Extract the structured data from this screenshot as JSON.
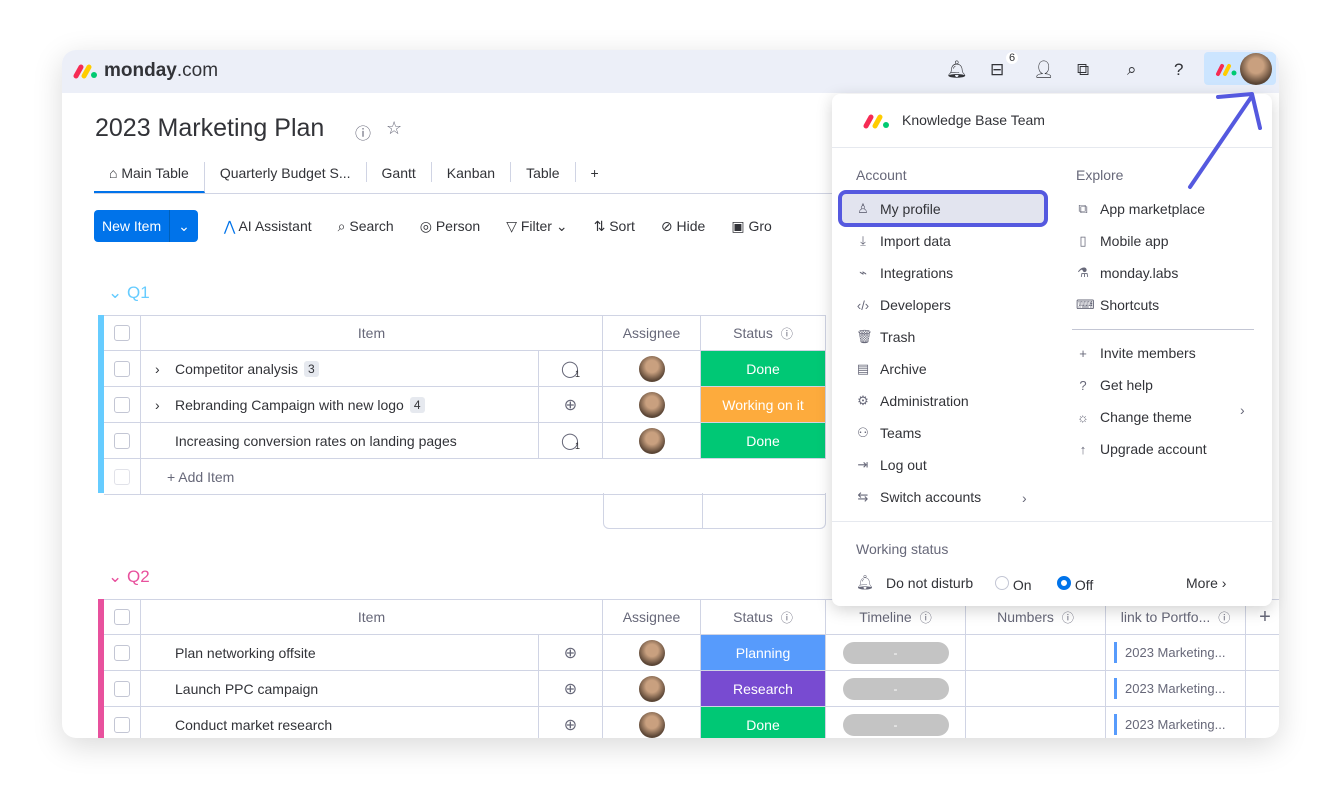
{
  "app": {
    "logo_text_bold": "monday",
    "logo_text_light": ".com",
    "inbox_count": "6"
  },
  "board": {
    "title": "2023 Marketing Plan"
  },
  "tabs": [
    "Main Table",
    "Quarterly Budget S...",
    "Gantt",
    "Kanban",
    "Table",
    "+"
  ],
  "toolbar": {
    "new_item": "New Item",
    "ai": "AI Assistant",
    "search": "Search",
    "person": "Person",
    "filter": "Filter",
    "sort": "Sort",
    "hide": "Hide",
    "group": "Gro"
  },
  "columns": {
    "item": "Item",
    "assignee": "Assignee",
    "status": "Status",
    "timeline": "Timeline",
    "numbers": "Numbers",
    "link": "link to Portfo..."
  },
  "groups": [
    {
      "name": "Q1",
      "color": "#66ccff",
      "add_item": "+ Add Item",
      "rows": [
        {
          "name": "Competitor analysis",
          "subitems": "3",
          "status": "Done",
          "status_color": "#00c875",
          "comments": "1"
        },
        {
          "name": "Rebranding Campaign with new logo",
          "subitems": "4",
          "status": "Working on it",
          "status_color": "#fdab3d",
          "comments": ""
        },
        {
          "name": "Increasing conversion rates on landing pages",
          "subitems": "",
          "status": "Done",
          "status_color": "#00c875",
          "comments": "1"
        }
      ]
    },
    {
      "name": "Q2",
      "color": "#e2445c",
      "rows": [
        {
          "name": "Plan networking offsite",
          "status": "Planning",
          "status_color": "#579bfc",
          "timeline": "-",
          "link": "2023 Marketing..."
        },
        {
          "name": "Launch PPC campaign",
          "status": "Research",
          "status_color": "#784bd1",
          "timeline": "-",
          "link": "2023 Marketing..."
        },
        {
          "name": "Conduct market research",
          "status": "Done",
          "status_color": "#00c875",
          "timeline": "-",
          "link": "2023 Marketing..."
        }
      ]
    }
  ],
  "menu": {
    "team": "Knowledge Base Team",
    "account_label": "Account",
    "explore_label": "Explore",
    "account": [
      {
        "label": "My profile",
        "icon": "person-icon"
      },
      {
        "label": "Import data",
        "icon": "download-icon"
      },
      {
        "label": "Integrations",
        "icon": "plug-icon"
      },
      {
        "label": "Developers",
        "icon": "code-icon"
      },
      {
        "label": "Trash",
        "icon": "trash-icon"
      },
      {
        "label": "Archive",
        "icon": "archive-icon"
      },
      {
        "label": "Administration",
        "icon": "gear-icon"
      },
      {
        "label": "Teams",
        "icon": "team-icon"
      },
      {
        "label": "Log out",
        "icon": "logout-icon"
      },
      {
        "label": "Switch accounts",
        "icon": "switch-icon"
      }
    ],
    "explore": [
      {
        "label": "App marketplace",
        "icon": "puzzle-icon"
      },
      {
        "label": "Mobile app",
        "icon": "mobile-icon"
      },
      {
        "label": "monday.labs",
        "icon": "flask-icon"
      },
      {
        "label": "Shortcuts",
        "icon": "keyboard-icon"
      }
    ],
    "more": [
      {
        "label": "Invite members",
        "icon": "plus-icon"
      },
      {
        "label": "Get help",
        "icon": "question-icon"
      },
      {
        "label": "Change theme",
        "icon": "sun-icon"
      },
      {
        "label": "Upgrade account",
        "icon": "arrow-up-icon"
      }
    ],
    "working_status": "Working status",
    "dnd": "Do not disturb",
    "on": "On",
    "off": "Off",
    "more_label": "More",
    "dnd_value": "Off"
  },
  "annotation_color": "#5559df"
}
